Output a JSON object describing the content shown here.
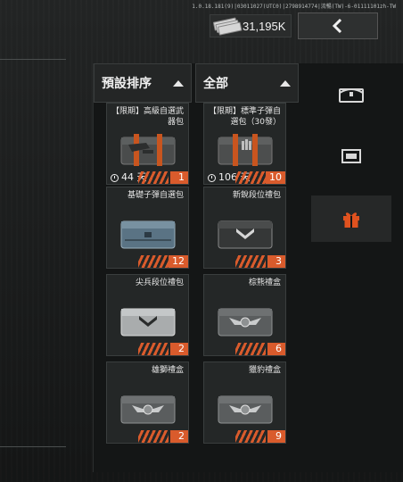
{
  "version_text": "1.0.18.181(9)|03011027(UTC0)|2798914774|流暢(TW)-6-01111101zh-TW",
  "currency": {
    "amount": "31,195K",
    "icon": "cash-stack-icon"
  },
  "back_button": {
    "icon": "chevron-left-icon"
  },
  "filters": {
    "sort_label": "預設排序",
    "category_label": "全部"
  },
  "side_tabs": [
    {
      "icon": "chest-icon"
    },
    {
      "icon": "crate-icon"
    },
    {
      "icon": "gift-icon",
      "color": "#e0521f"
    }
  ],
  "items": [
    {
      "title": "【限期】高級自選武器包",
      "timer": "44 天",
      "qty": "1",
      "box": "weapon"
    },
    {
      "title": "【限期】標準子彈自選包（30發）",
      "timer": "106 天",
      "qty": "10",
      "box": "ammo"
    },
    {
      "title": "基礎子彈自選包",
      "timer": "",
      "qty": "12",
      "box": "blue"
    },
    {
      "title": "新銳段位禮包",
      "timer": "",
      "qty": "3",
      "box": "dark"
    },
    {
      "title": "尖兵段位禮包",
      "timer": "",
      "qty": "2",
      "box": "silver"
    },
    {
      "title": "棕熊禮盒",
      "timer": "",
      "qty": "6",
      "box": "gray"
    },
    {
      "title": "雄獅禮盒",
      "timer": "",
      "qty": "2",
      "box": "gray"
    },
    {
      "title": "獵豹禮盒",
      "timer": "",
      "qty": "9",
      "box": "gray"
    }
  ],
  "colors": {
    "accent": "#d95b2c",
    "panel": "#141616",
    "card": "#242727"
  }
}
